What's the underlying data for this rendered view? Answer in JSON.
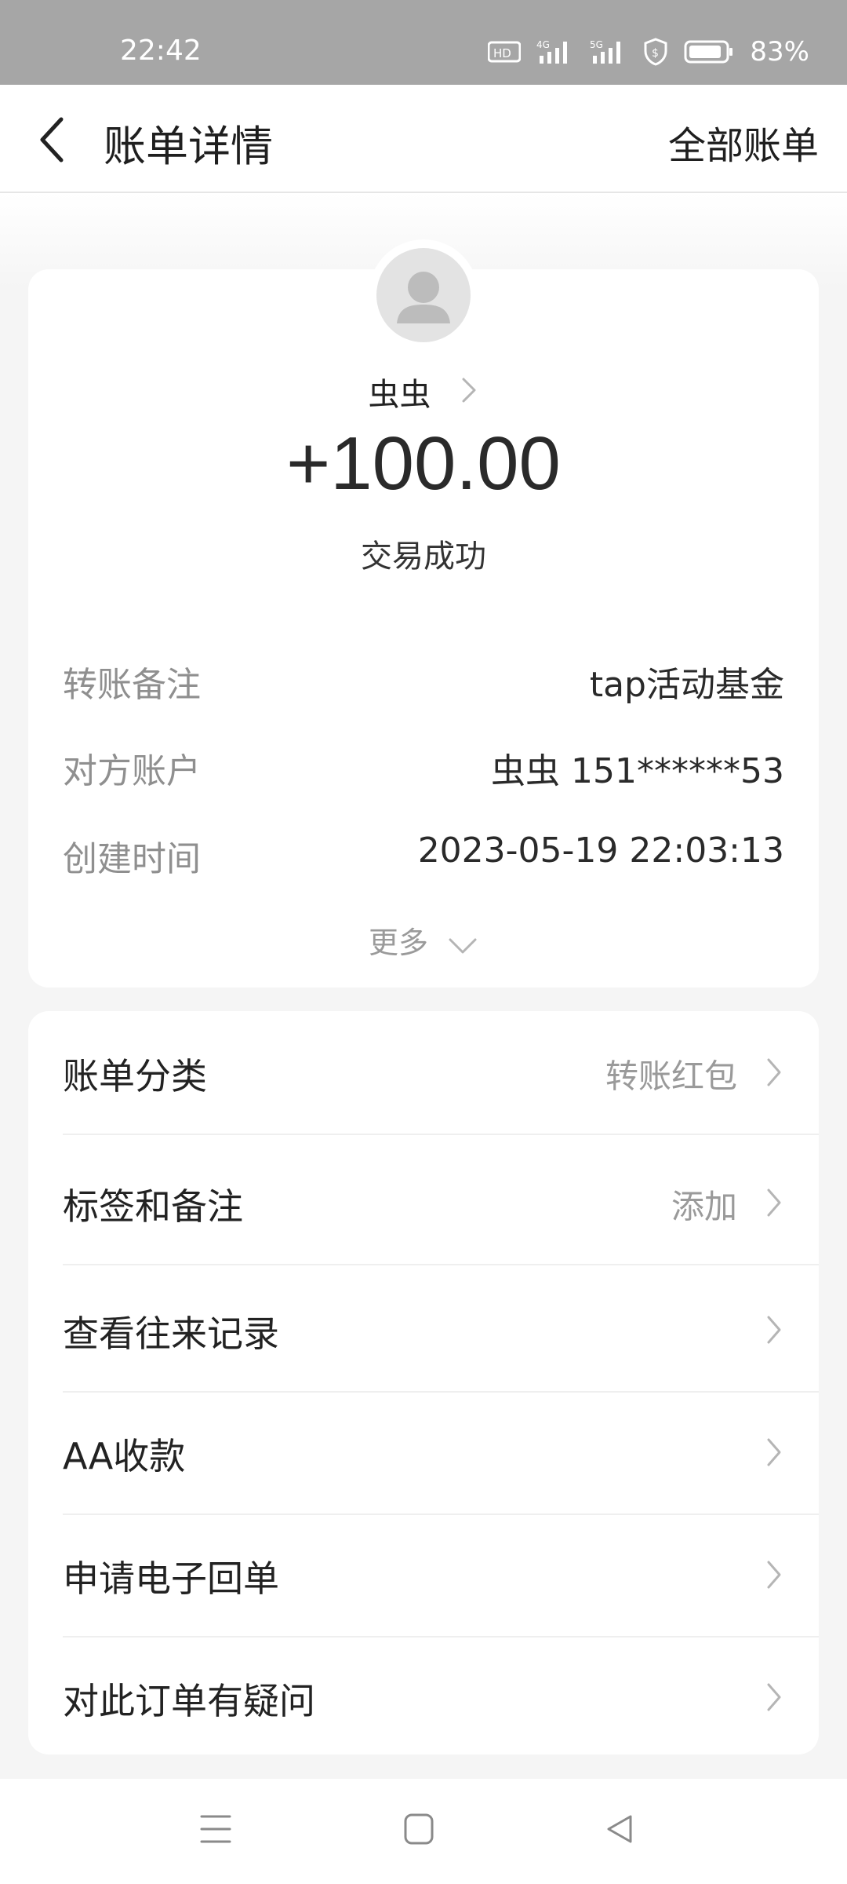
{
  "status_bar": {
    "time": "22:42",
    "battery": "83%",
    "icons": [
      "hd-icon",
      "4g-signal-icon",
      "5g-signal-icon",
      "shield-icon",
      "battery-icon"
    ]
  },
  "nav": {
    "title": "账单详情",
    "right_action": "全部账单"
  },
  "transaction": {
    "counterparty": "虫虫",
    "amount": "+100.00",
    "status": "交易成功"
  },
  "details": [
    {
      "label": "转账备注",
      "value": "tap活动基金"
    },
    {
      "label": "对方账户",
      "value": "虫虫 151******53"
    },
    {
      "label": "创建时间",
      "value": "2023-05-19 22:03:13"
    }
  ],
  "more_label": "更多",
  "menu": [
    {
      "label": "账单分类",
      "value": "转账红包"
    },
    {
      "label": "标签和备注",
      "value": "添加"
    },
    {
      "label": "查看往来记录",
      "value": ""
    },
    {
      "label": "AA收款",
      "value": ""
    },
    {
      "label": "申请电子回单",
      "value": ""
    },
    {
      "label": "对此订单有疑问",
      "value": ""
    }
  ]
}
